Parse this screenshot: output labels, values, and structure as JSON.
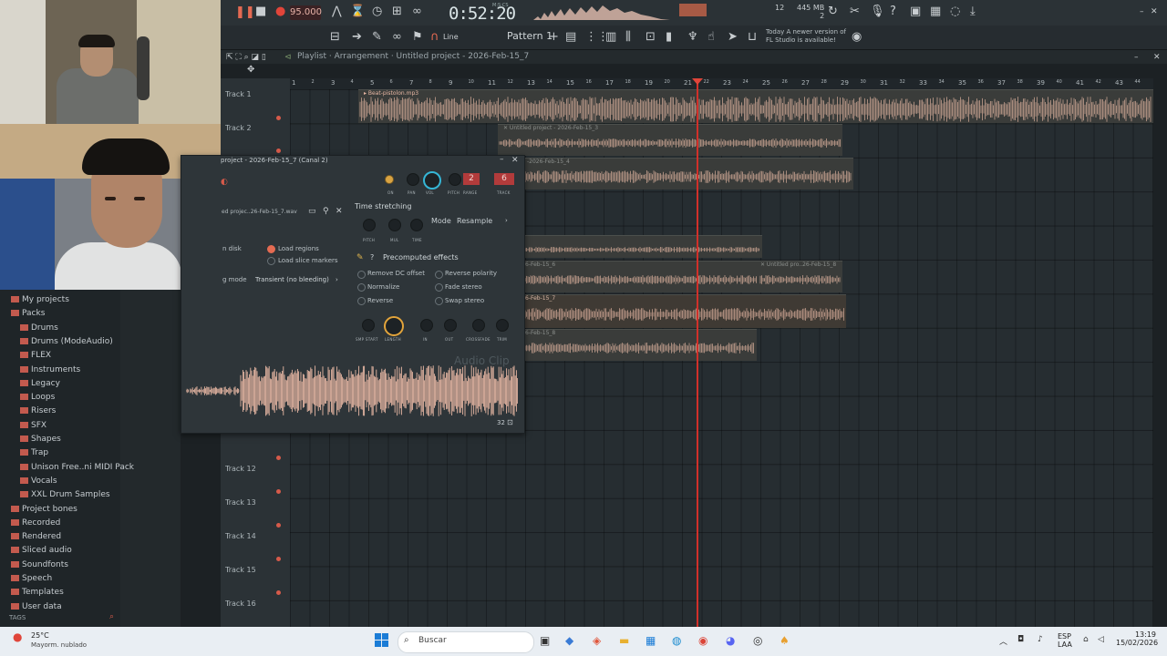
{
  "toolbar": {
    "tempo": "95.000",
    "time": "0:52:20",
    "time_unit": "M:S:CS",
    "pattern": "Pattern 1",
    "snap_mode": "Line",
    "memory": "445 MB",
    "cpu_count": "2",
    "meter_value": "12",
    "update_notice_line1": "Today  A newer version of",
    "update_notice_line2": "FL Studio is available!"
  },
  "playlist": {
    "breadcrumb": "Playlist · Arrangement · Untitled project - 2026-Feb-15_7",
    "ruler": [
      "1",
      "2",
      "3",
      "4",
      "5",
      "6",
      "7",
      "8",
      "9",
      "10",
      "11",
      "12",
      "13",
      "14",
      "15",
      "16",
      "17",
      "18",
      "19",
      "20",
      "21",
      "22",
      "23",
      "24",
      "25",
      "26",
      "27",
      "28",
      "29",
      "30",
      "31",
      "32",
      "33",
      "34",
      "35",
      "36",
      "37",
      "38",
      "39",
      "40",
      "41",
      "42",
      "43",
      "44"
    ],
    "tracks": [
      "Track 1",
      "Track 2",
      "Track 12",
      "Track 13",
      "Track 14",
      "Track 15",
      "Track 16"
    ],
    "clip_labels": {
      "c1": "▸ Beat-pistolon.mp3",
      "c2": "✕ Untitled project - 2026-Feb-15_3",
      "c3": "-2026-Feb-15_4",
      "c5": "6-Feb-15_6",
      "c5b": "✕ Untitled pro..26-Feb-15_8",
      "c6": "6-Feb-15_7",
      "c7": "6-Feb-15_8"
    }
  },
  "channel_window": {
    "title": "project - 2026-Feb-15_7 (Canal 2)",
    "file": "ed projec..26-Feb-15_7.wav",
    "knob_labels": [
      "ON",
      "PAN",
      "VOL",
      "PITCH",
      "RANGE",
      "TRACK"
    ],
    "range_value": "2",
    "track_value": "6",
    "time_stretching": "Time stretching",
    "mode_label": "Mode",
    "mode_value": "Resample",
    "stretch_labels": [
      "PITCH",
      "MUL",
      "TIME"
    ],
    "disk_label": "n disk",
    "load_regions": "Load regions",
    "load_slice_markers": "Load slice markers",
    "g_mode_label": "g mode",
    "g_mode_value": "Transient (no bleeding)",
    "precomputed": "Precomputed effects",
    "effects_left": [
      "Remove DC offset",
      "Normalize",
      "Reverse"
    ],
    "effects_right": [
      "Reverse polarity",
      "Fade stereo",
      "Swap stereo"
    ],
    "bottom_knobs": [
      "SMP START",
      "LENGTH",
      "IN",
      "OUT",
      "CROSSFADE",
      "TRIM"
    ],
    "watermark": "Audio Clip",
    "zoom_value": "32"
  },
  "browser": {
    "items": [
      "My projects",
      "Packs",
      "Drums",
      "Drums (ModeAudio)",
      "FLEX",
      "Instruments",
      "Legacy",
      "Loops",
      "Risers",
      "SFX",
      "Shapes",
      "Trap",
      "Unison Free..ni MIDI Pack",
      "Vocals",
      "XXL Drum Samples",
      "Project bones",
      "Recorded",
      "Rendered",
      "Sliced audio",
      "Soundfonts",
      "Speech",
      "Templates",
      "User data"
    ],
    "tags": "TAGS"
  },
  "taskbar": {
    "weather_temp": "25°C",
    "weather_desc": "Mayorm. nublado",
    "search_placeholder": "Buscar",
    "lang": "ESP",
    "lang2": "LAA",
    "clock_time": "13:19",
    "clock_date": "15/02/2026"
  },
  "colors": {
    "accent_record": "#d1302a",
    "waveform": "#e8b8a4",
    "folder": "#c35a4e"
  }
}
